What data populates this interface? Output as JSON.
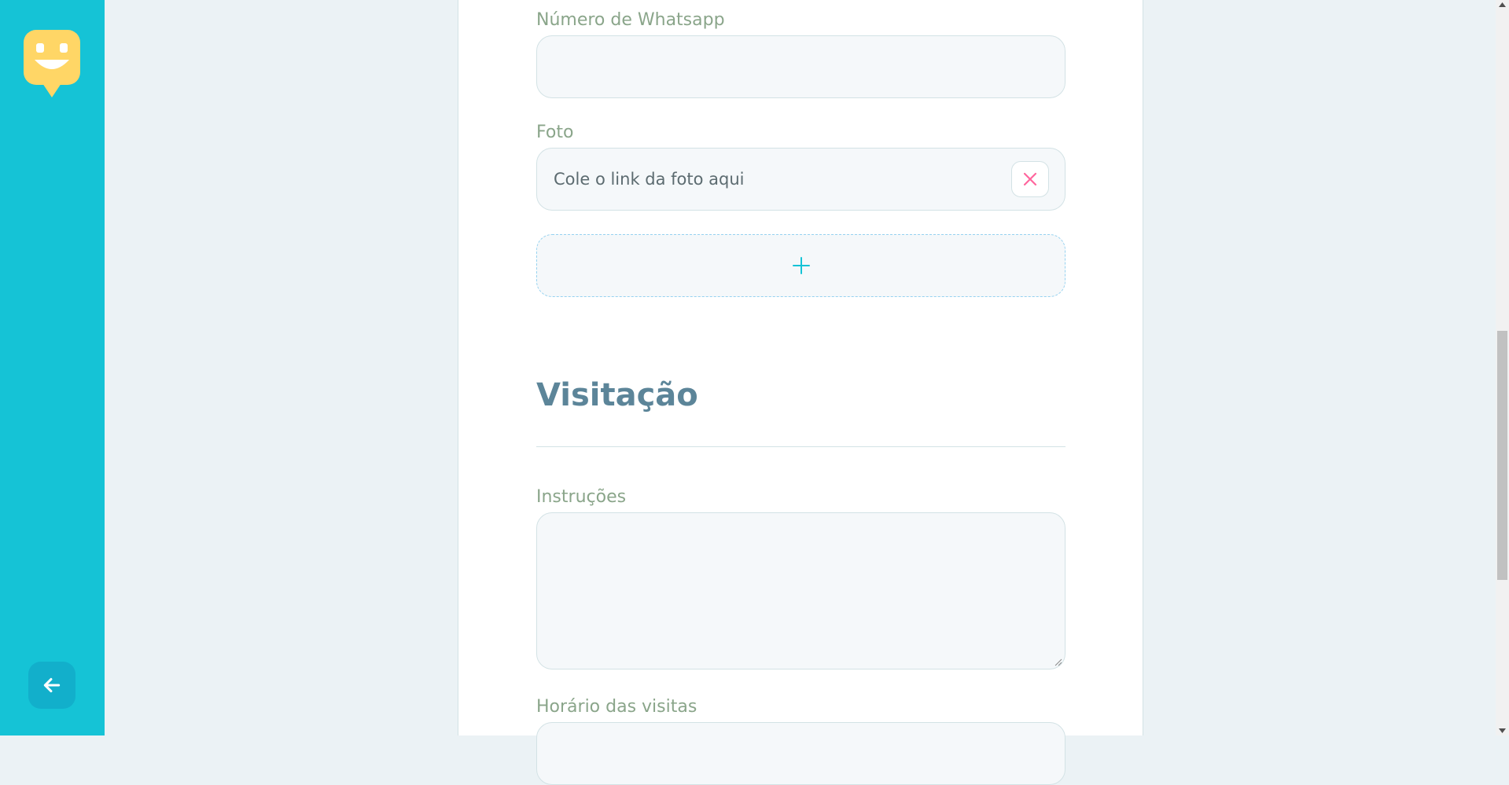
{
  "sidebar": {
    "logo_icon": "happy-face-speech-bubble-icon",
    "back_icon": "arrow-left-icon"
  },
  "form": {
    "whatsapp": {
      "label": "Número de Whatsapp",
      "value": ""
    },
    "photo": {
      "label": "Foto",
      "placeholder": "Cole o link da foto aqui",
      "remove_icon": "close-icon"
    },
    "add_photo_icon": "plus-icon",
    "visitation": {
      "title": "Visitação",
      "instructions": {
        "label": "Instruções",
        "value": ""
      },
      "visit_hours": {
        "label": "Horário das visitas"
      }
    }
  },
  "colors": {
    "sidebar": "#15c3d6",
    "accent": "#15c3d6",
    "logo": "#ffd666",
    "danger": "#ff669d",
    "section_title": "#5c8599"
  }
}
